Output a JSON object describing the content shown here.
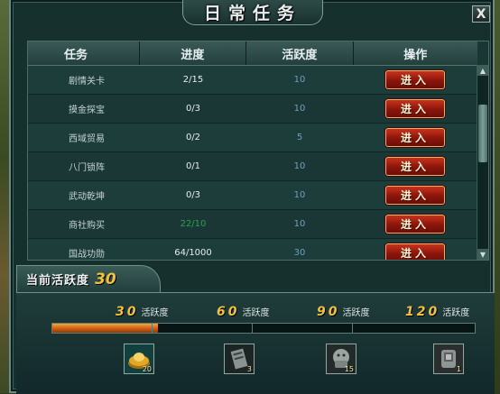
{
  "title": "日常任务",
  "close_label": "X",
  "table": {
    "headers": [
      "任务",
      "进度",
      "活跃度",
      "操作"
    ],
    "rows": [
      {
        "name": "剧情关卡",
        "progress": "2/15",
        "activity": "10",
        "action": "进入"
      },
      {
        "name": "摸金探宝",
        "progress": "0/3",
        "activity": "10",
        "action": "进入"
      },
      {
        "name": "西域贸易",
        "progress": "0/2",
        "activity": "5",
        "action": "进入"
      },
      {
        "name": "八门锁阵",
        "progress": "0/1",
        "activity": "10",
        "action": "进入"
      },
      {
        "name": "武动乾坤",
        "progress": "0/3",
        "activity": "10",
        "action": "进入"
      },
      {
        "name": "商社购买",
        "progress": "22/10",
        "activity": "10",
        "action": "进入",
        "progress_color": "#2fa04a"
      },
      {
        "name": "国战功勋",
        "progress": "64/1000",
        "activity": "30",
        "action": "进入"
      }
    ]
  },
  "current_activity": {
    "label": "当前活跃度",
    "value": "30"
  },
  "progress_fraction": 0.25,
  "milestones": [
    {
      "value": "30",
      "unit": "活跃度"
    },
    {
      "value": "60",
      "unit": "活跃度"
    },
    {
      "value": "90",
      "unit": "活跃度"
    },
    {
      "value": "120",
      "unit": "活跃度"
    }
  ],
  "rewards": [
    {
      "icon": "gold-ingot-icon",
      "count": "20",
      "color": "#d8a020"
    },
    {
      "icon": "scroll-card-icon",
      "count": "3",
      "color": "#9aa0a0"
    },
    {
      "icon": "stone-beast-icon",
      "count": "15",
      "color": "#b0b6b4"
    },
    {
      "icon": "stone-seal-icon",
      "count": "1",
      "color": "#a8a8a8"
    }
  ],
  "colors": {
    "accent_gold": "#f3c13a",
    "button_red": "#b02516",
    "activity_blue": "#6f9fc0",
    "progress_orange": "#e07a1c"
  }
}
